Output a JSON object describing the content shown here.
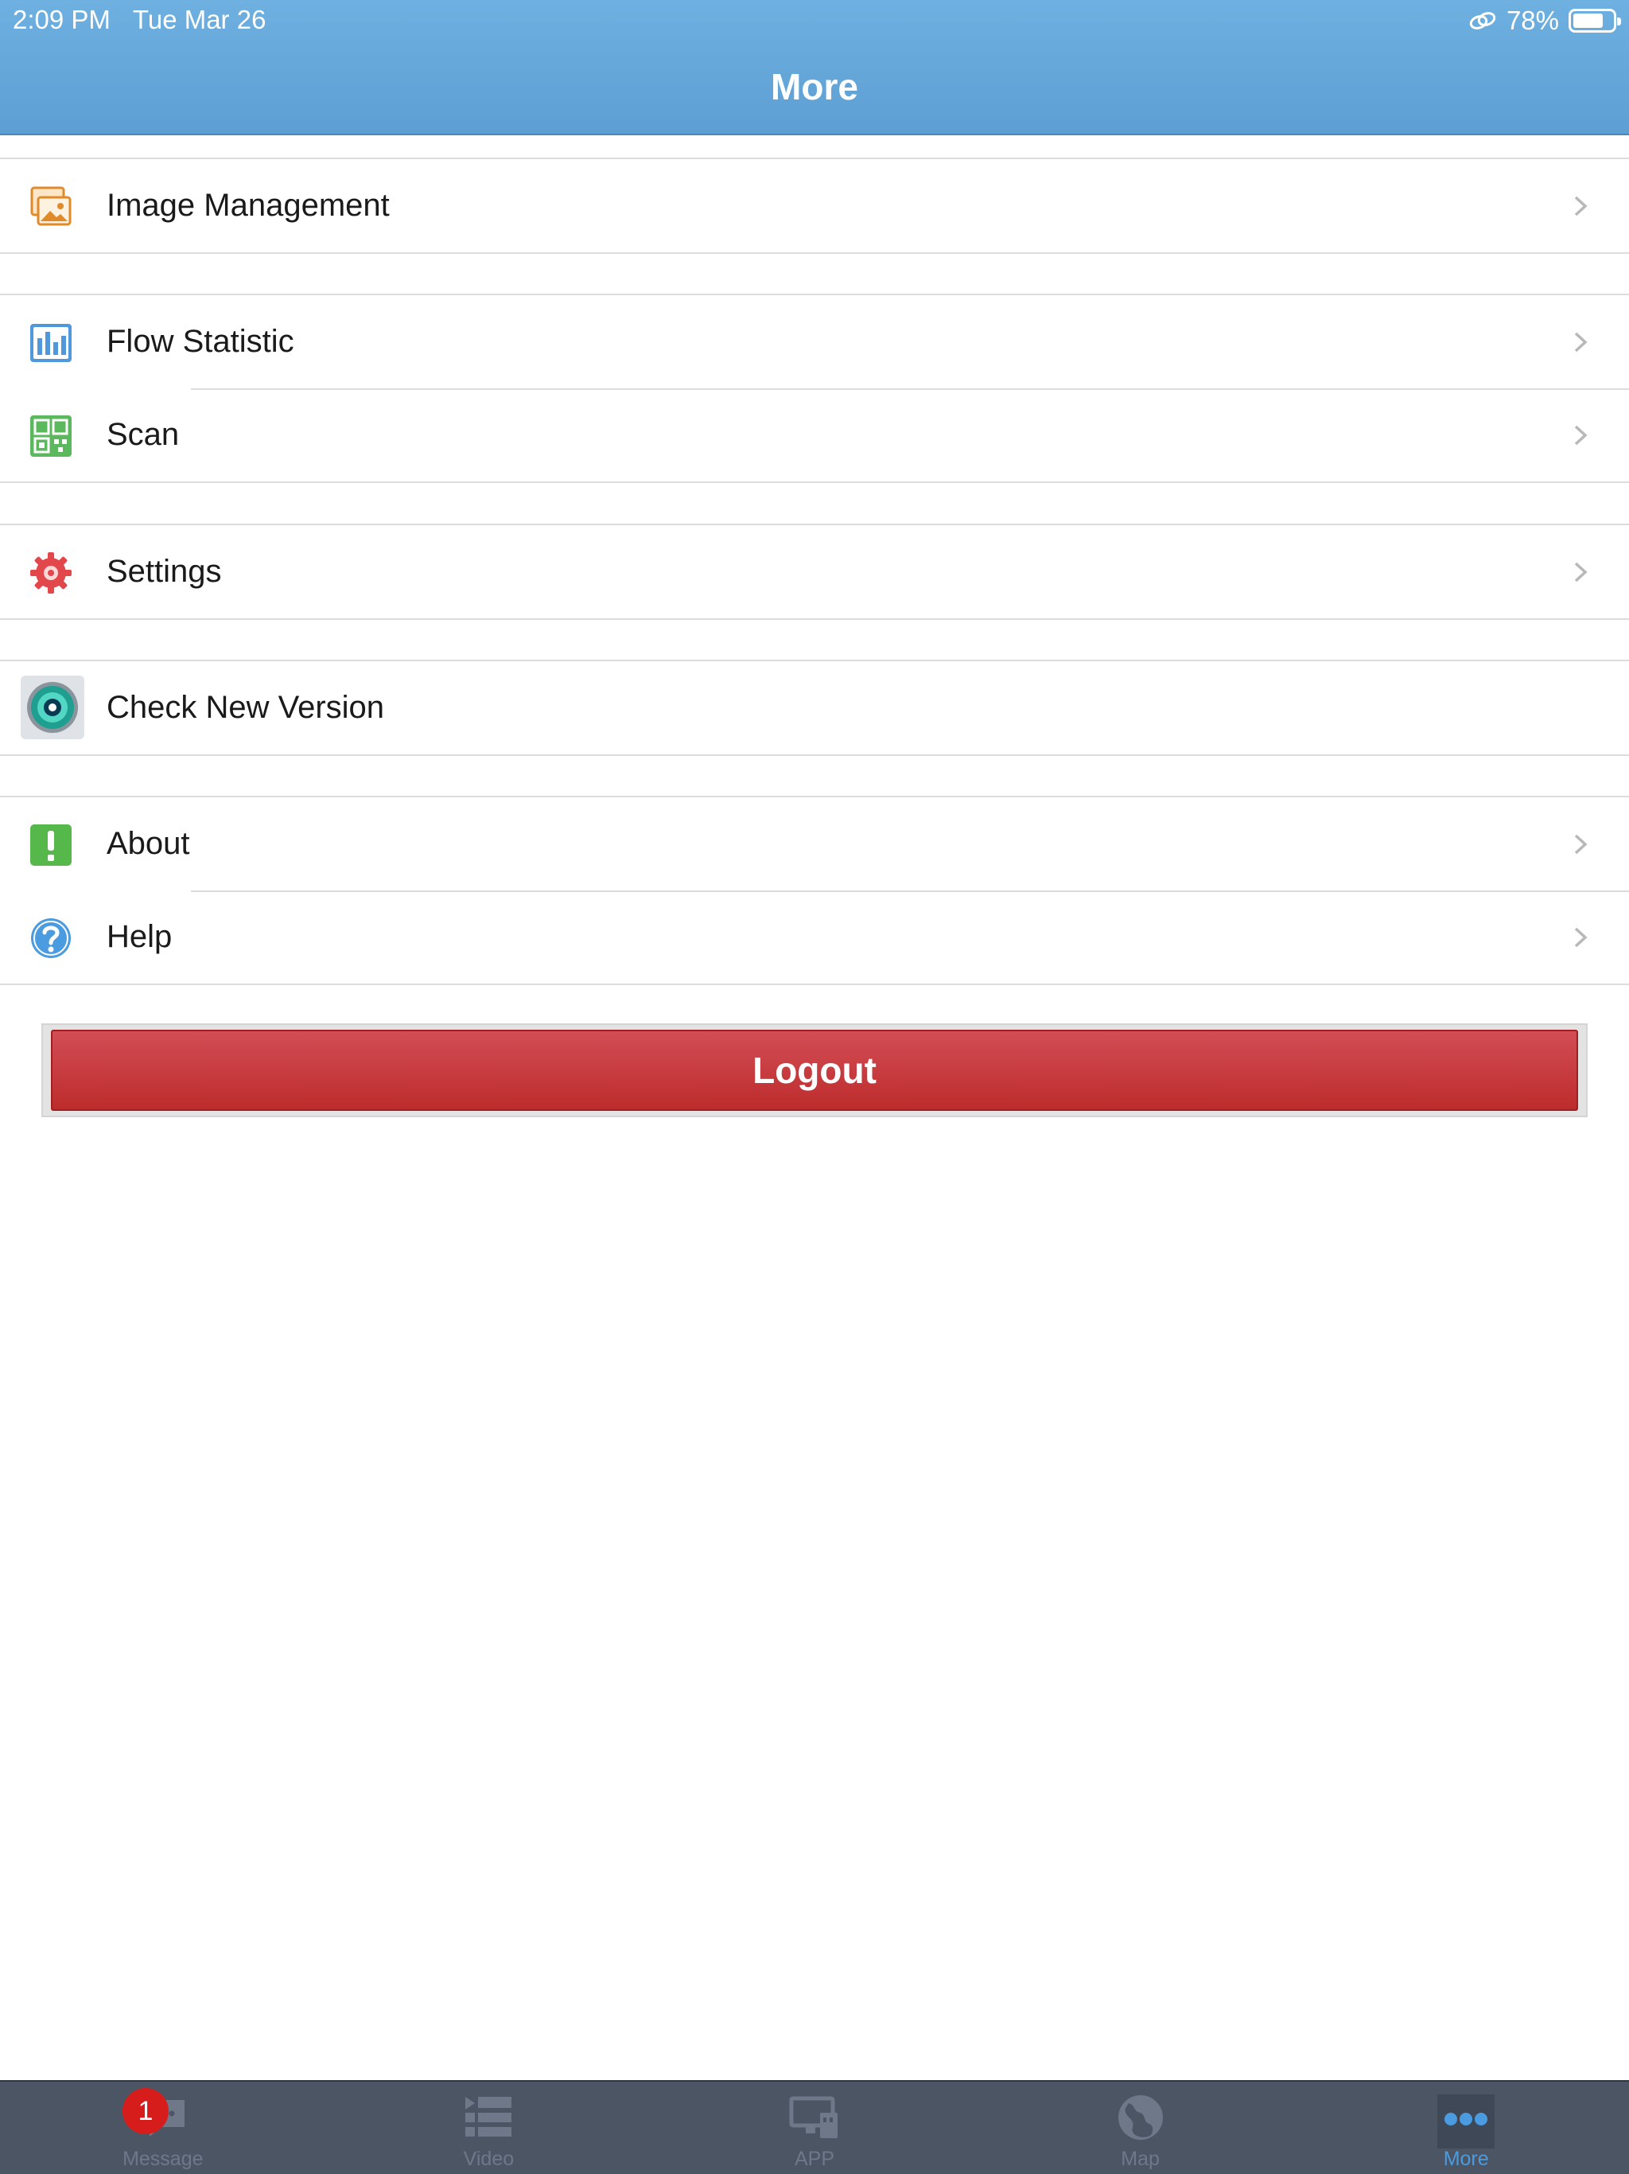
{
  "status_bar": {
    "time": "2:09 PM",
    "date": "Tue Mar 26",
    "battery_percent": "78%",
    "battery_level": 0.78
  },
  "header": {
    "title": "More"
  },
  "menu": {
    "image_management": "Image Management",
    "flow_statistic": "Flow Statistic",
    "scan": "Scan",
    "settings": "Settings",
    "check_new_version": "Check New Version",
    "about": "About",
    "help": "Help"
  },
  "logout": {
    "label": "Logout"
  },
  "tabbar": {
    "message": "Message",
    "message_badge": "1",
    "video": "Video",
    "app": "APP",
    "map": "Map",
    "more": "More",
    "active": "More"
  },
  "colors": {
    "header": "#5d9fd3",
    "logout": "#c83a40",
    "tabbar": "#4b5564",
    "active_tab": "#4a9be0",
    "badge": "#d71c1c"
  }
}
